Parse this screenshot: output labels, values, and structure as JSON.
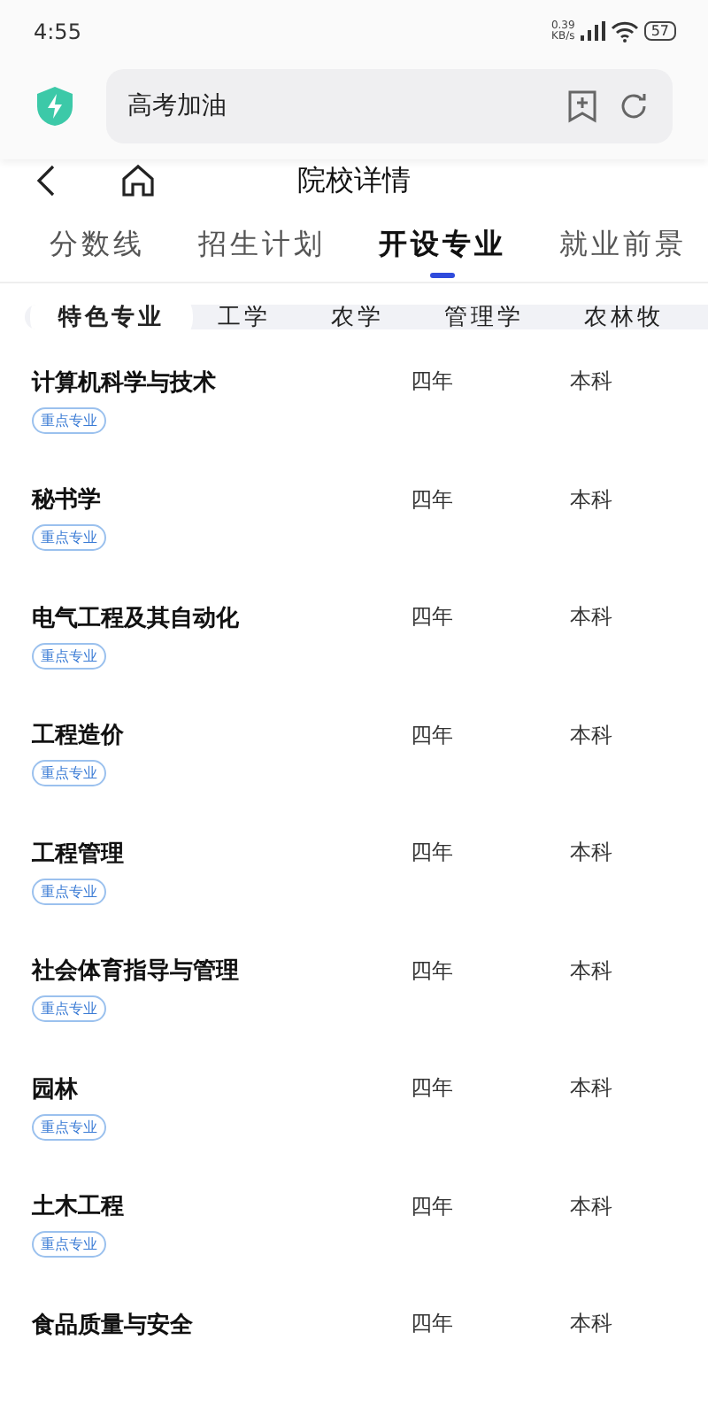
{
  "status_bar": {
    "time": "4:55",
    "net_speed": "0.39",
    "net_unit": "KB/s",
    "battery": "57"
  },
  "browser": {
    "address": "高考加油"
  },
  "header": {
    "title": "院校详情"
  },
  "tabs": [
    {
      "label": "分数线",
      "selected": false
    },
    {
      "label": "招生计划",
      "selected": false
    },
    {
      "label": "开设专业",
      "selected": true
    },
    {
      "label": "就业前景",
      "selected": false
    }
  ],
  "chips": [
    {
      "label": "特色专业",
      "selected": true
    },
    {
      "label": "工学",
      "selected": false
    },
    {
      "label": "农学",
      "selected": false
    },
    {
      "label": "管理学",
      "selected": false
    },
    {
      "label": "农林牧",
      "selected": false
    }
  ],
  "majors": [
    {
      "name": "计算机科学与技术",
      "duration": "四年",
      "level": "本科",
      "tag": "重点专业"
    },
    {
      "name": "秘书学",
      "duration": "四年",
      "level": "本科",
      "tag": "重点专业"
    },
    {
      "name": "电气工程及其自动化",
      "duration": "四年",
      "level": "本科",
      "tag": "重点专业"
    },
    {
      "name": "工程造价",
      "duration": "四年",
      "level": "本科",
      "tag": "重点专业"
    },
    {
      "name": "工程管理",
      "duration": "四年",
      "level": "本科",
      "tag": "重点专业"
    },
    {
      "name": "社会体育指导与管理",
      "duration": "四年",
      "level": "本科",
      "tag": "重点专业"
    },
    {
      "name": "园林",
      "duration": "四年",
      "level": "本科",
      "tag": "重点专业"
    },
    {
      "name": "土木工程",
      "duration": "四年",
      "level": "本科",
      "tag": "重点专业"
    },
    {
      "name": "食品质量与安全",
      "duration": "四年",
      "level": "本科"
    }
  ]
}
